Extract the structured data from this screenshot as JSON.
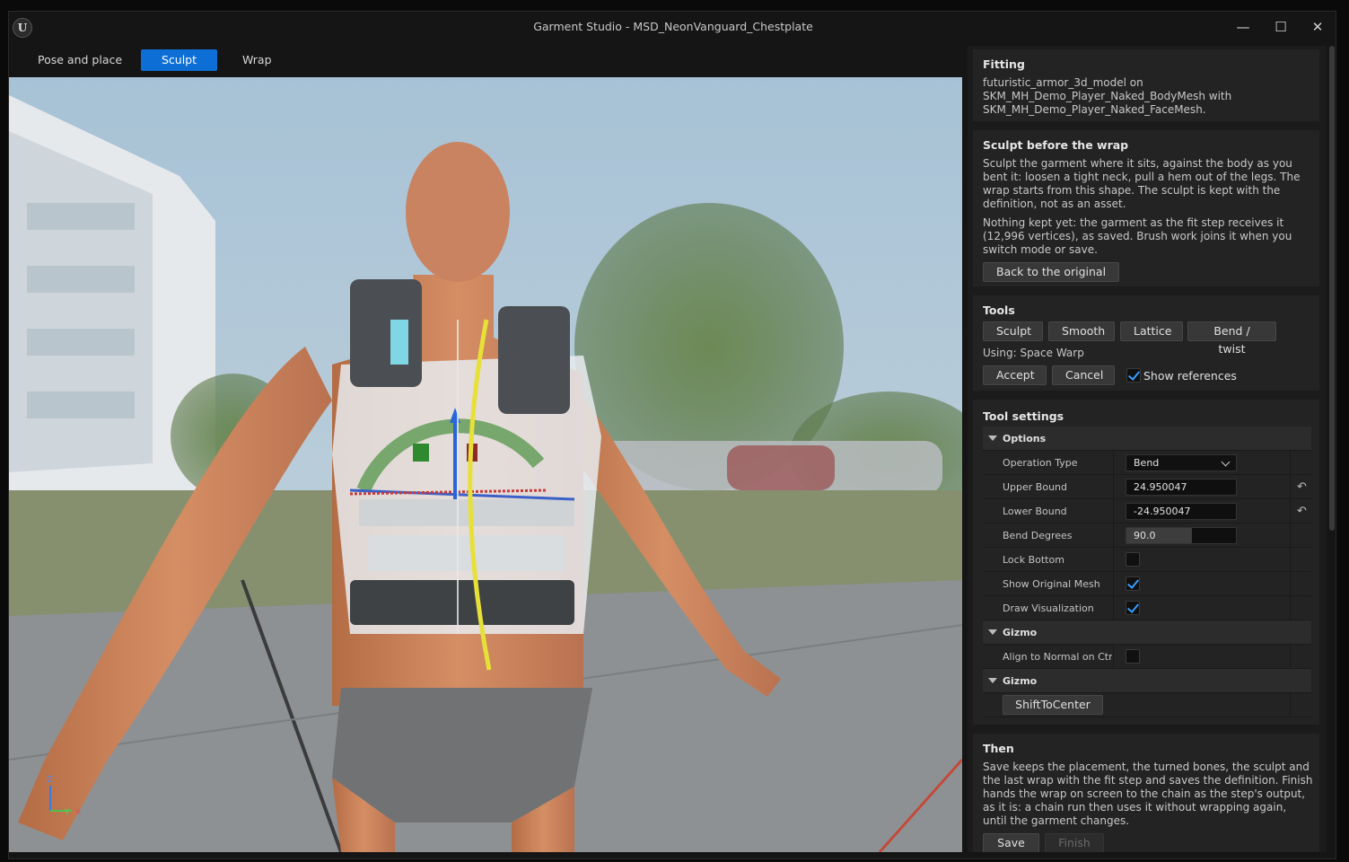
{
  "window": {
    "title": "Garment Studio - MSD_NeonVanguard_Chestplate",
    "logo": "U",
    "controls": {
      "minimize": "—",
      "maximize": "☐",
      "close": "✕"
    }
  },
  "modes": [
    {
      "label": "Pose and place",
      "active": false
    },
    {
      "label": "Sculpt",
      "active": true
    },
    {
      "label": "Wrap",
      "active": false
    }
  ],
  "viewport": {
    "axis_z": "Z",
    "axis_y": "Y",
    "axis_x": "X"
  },
  "fitting": {
    "heading": "Fitting",
    "text": "futuristic_armor_3d_model on SKM_MH_Demo_Player_Naked_BodyMesh with SKM_MH_Demo_Player_Naked_FaceMesh."
  },
  "sculpt": {
    "heading": "Sculpt before the wrap",
    "text1": "Sculpt the garment where it sits, against the body as you bent it: loosen a tight neck, pull a hem out of the legs. The wrap starts from this shape. The sculpt is kept with the definition, not as an asset.",
    "text2": "Nothing kept yet: the garment as the fit step receives it (12,996 vertices), as saved. Brush work joins it when you switch mode or save.",
    "back_button": "Back to the original"
  },
  "tools": {
    "heading": "Tools",
    "buttons": [
      "Sculpt",
      "Smooth",
      "Lattice",
      "Bend / twist"
    ],
    "using": "Using: Space Warp",
    "accept": "Accept",
    "cancel": "Cancel",
    "show_references": "Show references",
    "show_references_checked": true
  },
  "tool_settings": {
    "heading": "Tool settings",
    "options_group": "Options",
    "operation_type_label": "Operation Type",
    "operation_type_value": "Bend",
    "upper_bound_label": "Upper Bound",
    "upper_bound_value": "24.950047",
    "lower_bound_label": "Lower Bound",
    "lower_bound_value": "-24.950047",
    "bend_degrees_label": "Bend Degrees",
    "bend_degrees_value": "90.0",
    "bend_degrees_fraction": 0.6,
    "lock_bottom_label": "Lock Bottom",
    "lock_bottom": false,
    "show_original_label": "Show Original Mesh",
    "show_original": true,
    "draw_vis_label": "Draw Visualization",
    "draw_vis": true,
    "gizmo_group_1": "Gizmo",
    "align_label": "Align to Normal on Ctrl...",
    "align": false,
    "gizmo_group_2": "Gizmo",
    "shift_button": "ShiftToCenter",
    "reset_icon": "↶"
  },
  "then": {
    "heading": "Then",
    "text": "Save keeps the placement, the turned bones, the sculpt and the last wrap with the fit step and saves the definition. Finish hands the wrap on screen to the chain as the step's output, as it is: a chain run then uses it without wrapping again, until the garment changes.",
    "save": "Save",
    "finish": "Finish"
  }
}
